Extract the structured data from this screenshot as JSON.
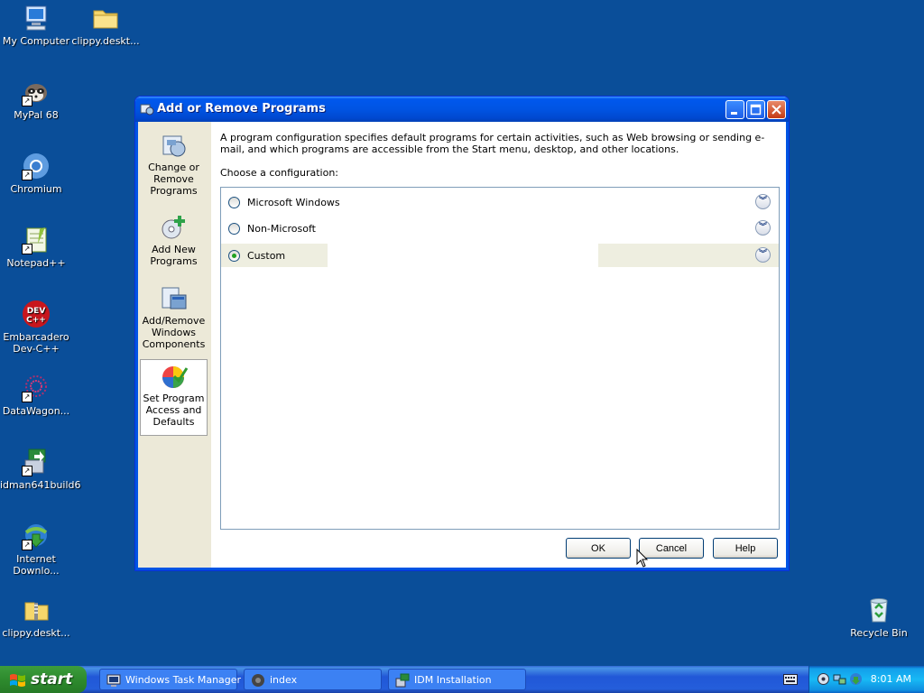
{
  "desktop_icons": [
    {
      "label": "My Computer",
      "icon": "computer-icon"
    },
    {
      "label": "clippy.deskt...",
      "icon": "folder-icon"
    },
    {
      "label": "MyPal 68",
      "icon": "raccoon-icon"
    },
    {
      "label": "Chromium",
      "icon": "chromium-icon"
    },
    {
      "label": "Notepad++",
      "icon": "notepadpp-icon"
    },
    {
      "label": "Embarcadero Dev-C++",
      "icon": "devcpp-icon"
    },
    {
      "label": "DataWagon...",
      "icon": "datawagon-icon"
    },
    {
      "label": "idman641build6",
      "icon": "idm-installer-icon"
    },
    {
      "label": "Internet Downlo...",
      "icon": "idm-icon"
    },
    {
      "label": "clippy.deskt...",
      "icon": "zip-folder-icon"
    },
    {
      "label": "Recycle Bin",
      "icon": "recycle-bin-icon"
    }
  ],
  "window": {
    "title": "Add or Remove Programs",
    "sidebar": [
      {
        "label": "Change or Remove Programs",
        "icon": "change-remove-icon"
      },
      {
        "label": "Add New Programs",
        "icon": "add-programs-icon"
      },
      {
        "label": "Add/Remove Windows Components",
        "icon": "windows-components-icon"
      },
      {
        "label": "Set Program Access and Defaults",
        "icon": "program-access-icon",
        "selected": true
      }
    ],
    "description": "A program configuration specifies default programs for certain activities, such as Web browsing or sending e-mail, and which programs are accessible from the Start menu, desktop, and other locations.",
    "choose_label": "Choose a configuration:",
    "configurations": [
      {
        "label": "Microsoft Windows",
        "selected": false
      },
      {
        "label": "Non-Microsoft",
        "selected": false
      },
      {
        "label": "Custom",
        "selected": true
      }
    ],
    "buttons": {
      "ok": "OK",
      "cancel": "Cancel",
      "help": "Help"
    }
  },
  "taskbar": {
    "start_label": "start",
    "tasks": [
      {
        "label": "Windows Task Manager",
        "icon": "task-manager-icon",
        "active": false
      },
      {
        "label": "index",
        "icon": "chromium-icon",
        "active": false
      },
      {
        "label": "IDM Installation",
        "icon": "idm-installer-icon",
        "active": false
      }
    ],
    "clock": "8:01 AM"
  },
  "colors": {
    "desktop": "#0a4e99",
    "titlebar": "#0054e3",
    "window_bg": "#ece9d8",
    "start_green": "#2e8b2e"
  }
}
